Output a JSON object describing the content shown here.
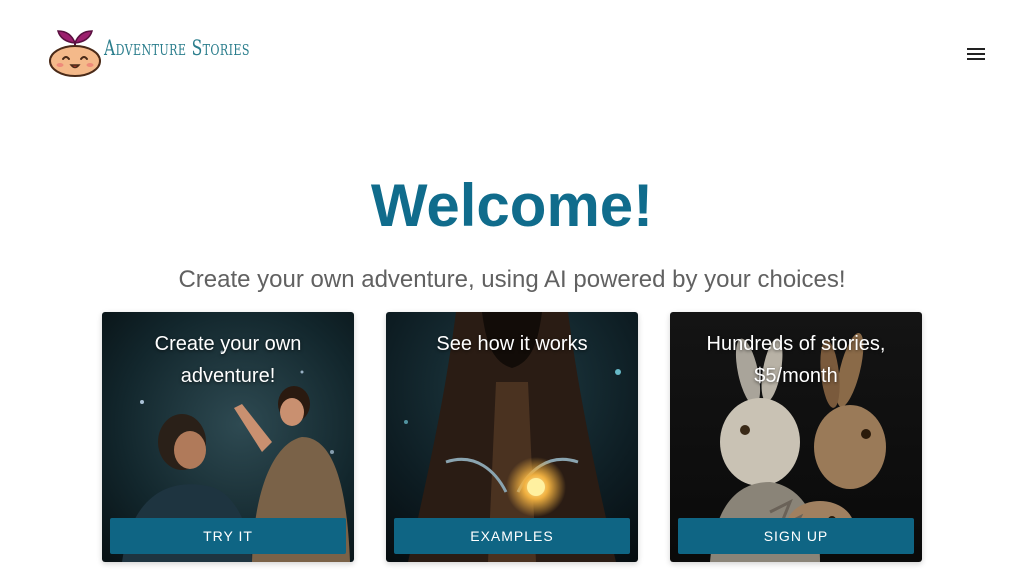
{
  "header": {
    "logo_text": "Adventure Stories",
    "menu_icon": "hamburger-menu-icon"
  },
  "hero": {
    "title": "Welcome!",
    "subtitle": "Create your own adventure, using AI powered by your choices!"
  },
  "cards": [
    {
      "title": "Create your own adventure!",
      "button": "TRY IT"
    },
    {
      "title": "See how it works",
      "button": "EXAMPLES"
    },
    {
      "title": "Hundreds of stories, $5/month",
      "button": "SIGN UP"
    }
  ],
  "colors": {
    "accent": "#106c8c",
    "button": "#0f6584",
    "subtitle": "#616161",
    "logo_text": "#2a7d8c"
  }
}
